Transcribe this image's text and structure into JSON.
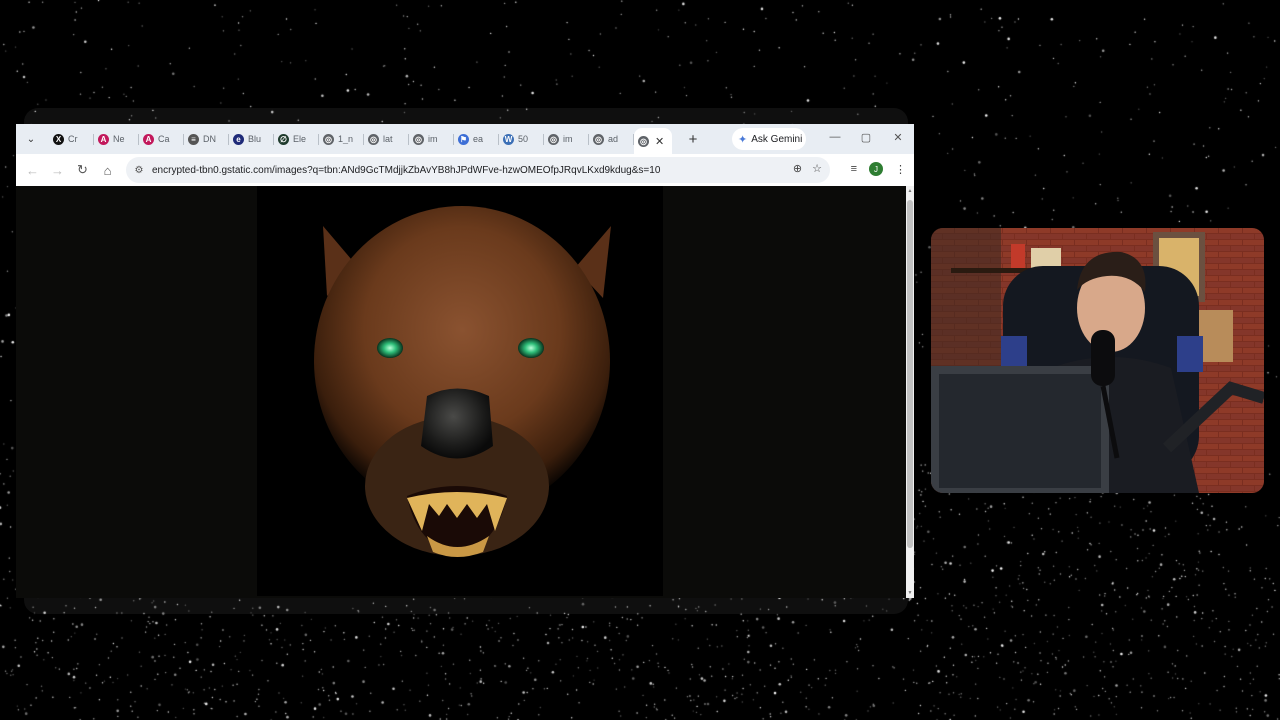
{
  "browser": {
    "tabs": [
      {
        "label": "Cr",
        "icon": "x-icon",
        "color": "#111111",
        "glyph": "X"
      },
      {
        "label": "Ne",
        "icon": "app-icon",
        "color": "#c2185b",
        "glyph": "A"
      },
      {
        "label": "Ca",
        "icon": "app-icon",
        "color": "#c2185b",
        "glyph": "A"
      },
      {
        "label": "DN",
        "icon": "lines-icon",
        "color": "#555555",
        "glyph": "≡"
      },
      {
        "label": "Blu",
        "icon": "e-icon",
        "color": "#1e2a78",
        "glyph": "e"
      },
      {
        "label": "Ele",
        "icon": "leaf-icon",
        "color": "#1f3b2d",
        "glyph": "∅"
      },
      {
        "label": "1_n",
        "icon": "globe-icon",
        "color": "#5f6368",
        "glyph": "◎"
      },
      {
        "label": "lat",
        "icon": "globe-icon",
        "color": "#5f6368",
        "glyph": "◎"
      },
      {
        "label": "im",
        "icon": "globe-icon",
        "color": "#5f6368",
        "glyph": "◎"
      },
      {
        "label": "ea",
        "icon": "flag-icon",
        "color": "#3d6fd6",
        "glyph": "⚑"
      },
      {
        "label": "50",
        "icon": "w-icon",
        "color": "#3b6fb6",
        "glyph": "W"
      },
      {
        "label": "im",
        "icon": "globe-icon",
        "color": "#5f6368",
        "glyph": "◎"
      },
      {
        "label": "ad",
        "icon": "globe-icon",
        "color": "#5f6368",
        "glyph": "◎"
      }
    ],
    "active_tab": {
      "icon": "globe-icon"
    },
    "gemini_label": "Ask Gemini",
    "url": "encrypted-tbn0.gstatic.com/images?q=tbn:ANd9GcTMdjjkZbAvYB8hJPdWFve-hzwOMEOfpJRqvLKxd9kdug&s=10",
    "profile_initial": "J"
  }
}
